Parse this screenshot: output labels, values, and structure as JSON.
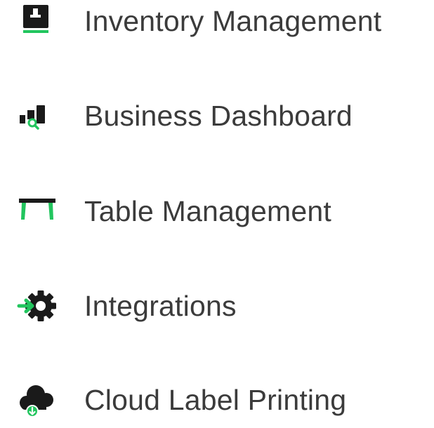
{
  "colors": {
    "icon_dark": "#1a1a1a",
    "accent_green": "#22c55e",
    "label_text": "#3b3b3b"
  },
  "features": [
    {
      "label": "Inventory Management",
      "icon": "inventory-box-icon"
    },
    {
      "label": "Business Dashboard",
      "icon": "dashboard-chart-icon"
    },
    {
      "label": "Table Management",
      "icon": "table-icon"
    },
    {
      "label": "Integrations",
      "icon": "integration-gear-icon"
    },
    {
      "label": "Cloud Label Printing",
      "icon": "cloud-download-icon"
    }
  ]
}
